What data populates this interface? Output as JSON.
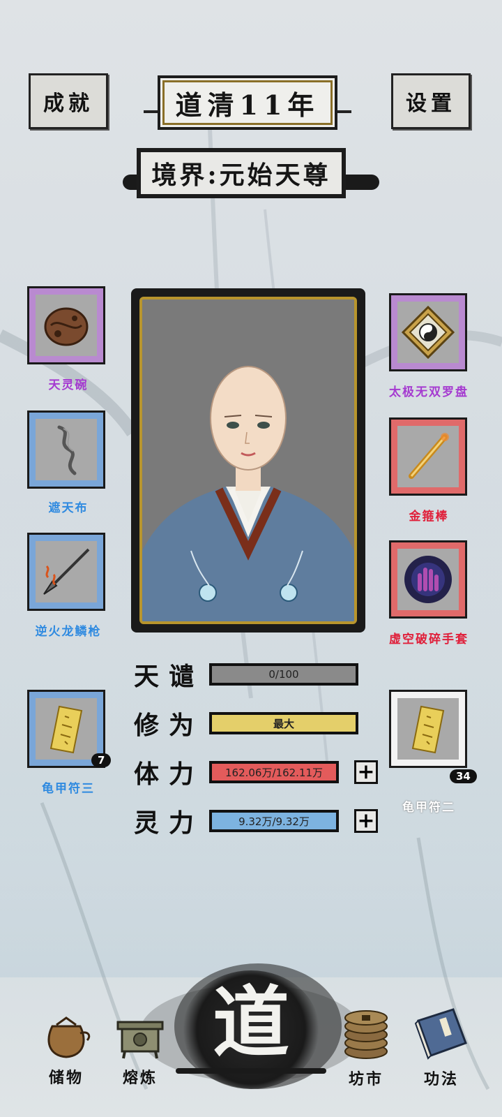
{
  "header": {
    "achievement_label": "成就",
    "year_title": "道清11年",
    "settings_label": "设置",
    "realm": "境界:元始天尊"
  },
  "equipment_left": [
    {
      "name": "天灵碗",
      "rarity_color": "#a53ad0"
    },
    {
      "name": "遮天布",
      "rarity_color": "#2f8ae0"
    },
    {
      "name": "逆火龙鳞枪",
      "rarity_color": "#2f8ae0"
    },
    {
      "name": "龟甲符三",
      "rarity_color": "#2f8ae0",
      "count": "7"
    }
  ],
  "equipment_right": [
    {
      "name": "太极无双罗盘",
      "rarity_color": "#a53ad0"
    },
    {
      "name": "金箍棒",
      "rarity_color": "#e01f3a"
    },
    {
      "name": "虚空破碎手套",
      "rarity_color": "#e01f3a"
    },
    {
      "name": "龟甲符二",
      "rarity_color": "#ffffff",
      "count": "34"
    }
  ],
  "stats": {
    "tianqian": {
      "label": "天谴",
      "value": "0/100",
      "fill": 0.0,
      "color": "#8a8a8a"
    },
    "xiuwei": {
      "label": "修为",
      "value": "最大",
      "fill": 1.0,
      "color": "#e4cf6a"
    },
    "tili": {
      "label": "体力",
      "value": "162.06万/162.11万",
      "fill": 0.9997,
      "color": "#e35b5b"
    },
    "lingli": {
      "label": "灵力",
      "value": "9.32万/9.32万",
      "fill": 1.0,
      "color": "#7db3e0"
    }
  },
  "bottom_nav": {
    "storage": "储物",
    "refine": "熔炼",
    "center": "道",
    "market": "坊市",
    "skills": "功法"
  }
}
